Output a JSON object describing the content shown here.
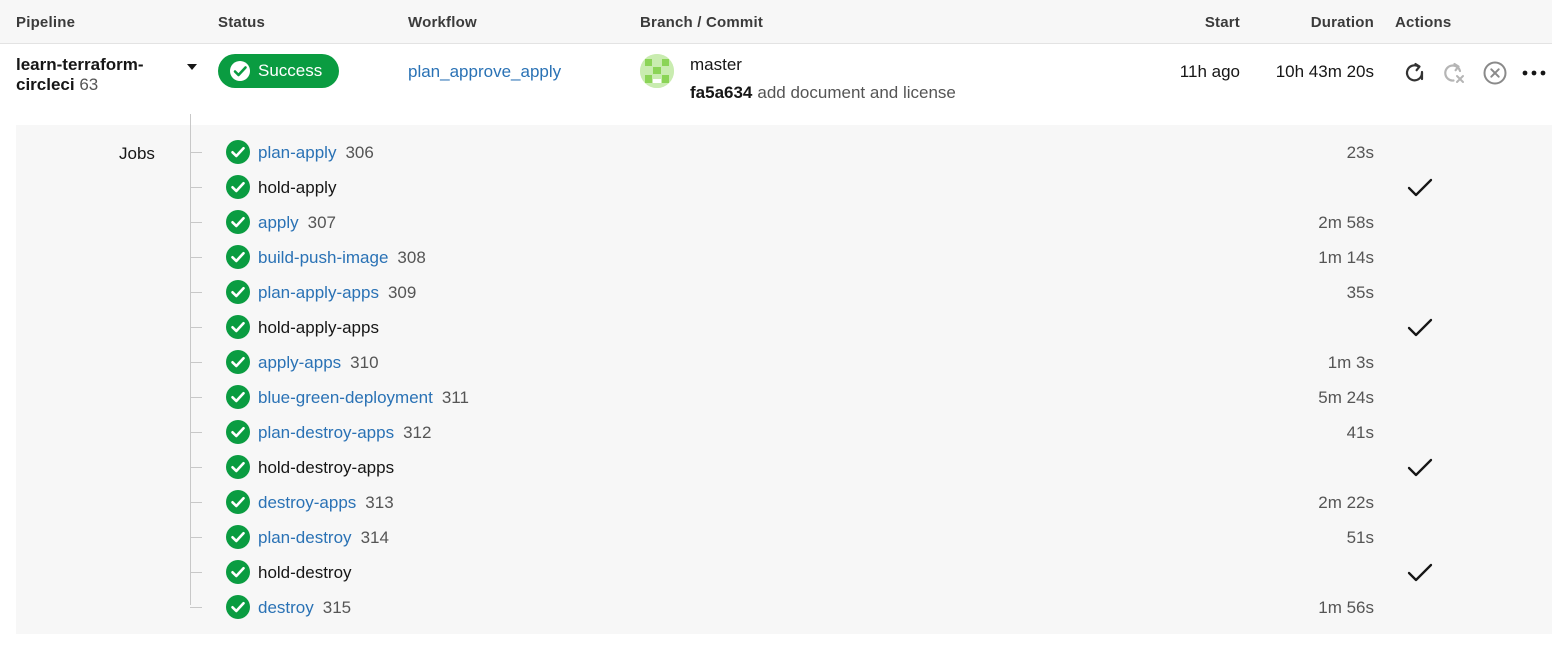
{
  "headers": {
    "pipeline": "Pipeline",
    "status": "Status",
    "workflow": "Workflow",
    "branch_commit": "Branch / Commit",
    "start": "Start",
    "duration": "Duration",
    "actions": "Actions"
  },
  "pipeline": {
    "name_line1": "learn-terraform-",
    "name_line2": "circleci",
    "number": "63",
    "status": "Success",
    "workflow": "plan_approve_apply",
    "branch": "master",
    "commit_hash": "fa5a634",
    "commit_message": "add document and license",
    "start": "11h ago",
    "duration": "10h 43m 20s"
  },
  "actions": {
    "icons": [
      "rerun-icon",
      "rerun-failed-icon",
      "cancel-icon",
      "more-icon"
    ]
  },
  "jobs_label": "Jobs",
  "colors": {
    "success": "#0a9c41",
    "link": "#2a72b5",
    "panel": "#f7f7f7"
  },
  "jobs": [
    {
      "name": "plan-apply",
      "number": "306",
      "duration": "23s",
      "link": true,
      "approval": false
    },
    {
      "name": "hold-apply",
      "number": "",
      "duration": "",
      "link": false,
      "approval": true
    },
    {
      "name": "apply",
      "number": "307",
      "duration": "2m 58s",
      "link": true,
      "approval": false
    },
    {
      "name": "build-push-image",
      "number": "308",
      "duration": "1m 14s",
      "link": true,
      "approval": false
    },
    {
      "name": "plan-apply-apps",
      "number": "309",
      "duration": "35s",
      "link": true,
      "approval": false
    },
    {
      "name": "hold-apply-apps",
      "number": "",
      "duration": "",
      "link": false,
      "approval": true
    },
    {
      "name": "apply-apps",
      "number": "310",
      "duration": "1m 3s",
      "link": true,
      "approval": false
    },
    {
      "name": "blue-green-deployment",
      "number": "311",
      "duration": "5m 24s",
      "link": true,
      "approval": false
    },
    {
      "name": "plan-destroy-apps",
      "number": "312",
      "duration": "41s",
      "link": true,
      "approval": false
    },
    {
      "name": "hold-destroy-apps",
      "number": "",
      "duration": "",
      "link": false,
      "approval": true
    },
    {
      "name": "destroy-apps",
      "number": "313",
      "duration": "2m 22s",
      "link": true,
      "approval": false
    },
    {
      "name": "plan-destroy",
      "number": "314",
      "duration": "51s",
      "link": true,
      "approval": false
    },
    {
      "name": "hold-destroy",
      "number": "",
      "duration": "",
      "link": false,
      "approval": true
    },
    {
      "name": "destroy",
      "number": "315",
      "duration": "1m 56s",
      "link": true,
      "approval": false
    }
  ]
}
